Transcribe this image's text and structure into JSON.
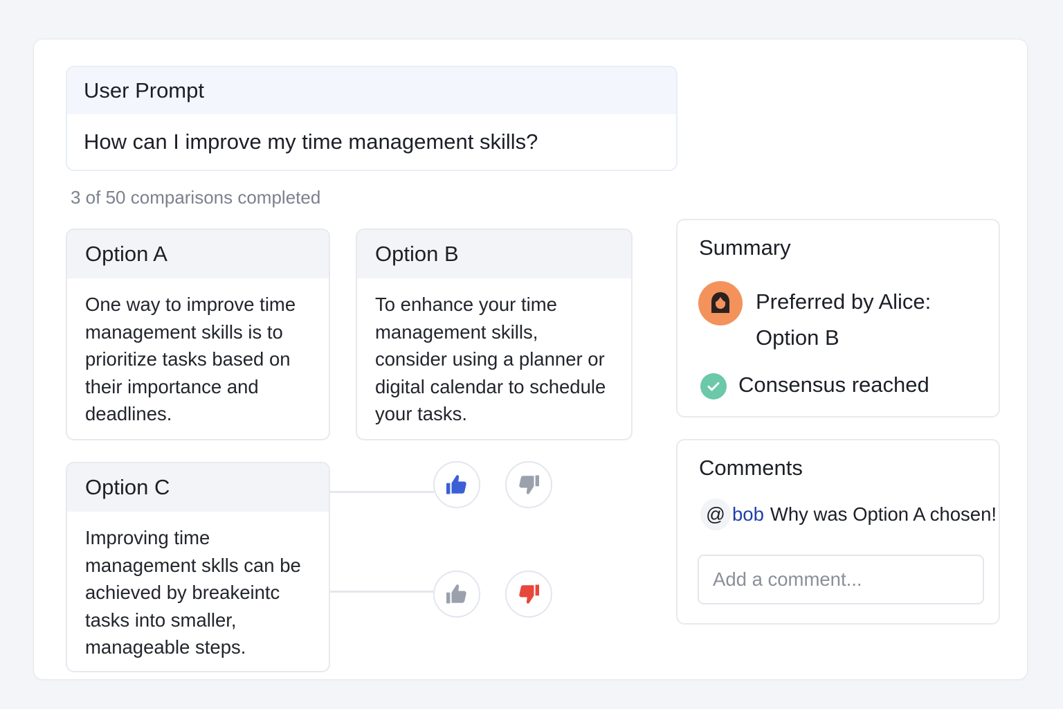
{
  "prompt": {
    "title": "User Prompt",
    "text": "How can I improve my time management skills?"
  },
  "progress": "3 of 50 comparisons completed",
  "options": [
    {
      "title": "Option A",
      "text": "One way to improve time management skills is to prioritize tasks based on their importance and deadlines."
    },
    {
      "title": "Option B",
      "text": "To enhance your time management skills, consider using a planner or digital calendar to schedule your tasks."
    },
    {
      "title": "Option C",
      "text": "Improving time management sklls can be achieved by breakeintc tasks into smaller, manageable steps."
    }
  ],
  "votes": [
    {
      "upvote_icon": "thumbs-up-icon",
      "upvote_active": true,
      "upvote_color": "#3b5fd4",
      "downvote_icon": "thumbs-down-icon",
      "downvote_active": false,
      "downvote_color": "#9aa1ad"
    },
    {
      "upvote_icon": "thumbs-up-icon",
      "upvote_active": false,
      "upvote_color": "#9aa1ad",
      "downvote_icon": "thumbs-down-icon",
      "downvote_active": true,
      "downvote_color": "#e8473b"
    }
  ],
  "summary": {
    "title": "Summary",
    "preferred_label": "Preferred by Alice:",
    "preferred_value": "Option B",
    "consensus": "Consensus reached",
    "avatar_color": "#f4925c",
    "check_color": "#6bc8a8"
  },
  "comments": {
    "title": "Comments",
    "items": [
      {
        "at": "@",
        "user": "bob",
        "text": "Why was Option A chosen!"
      }
    ],
    "placeholder": "Add a comment..."
  }
}
